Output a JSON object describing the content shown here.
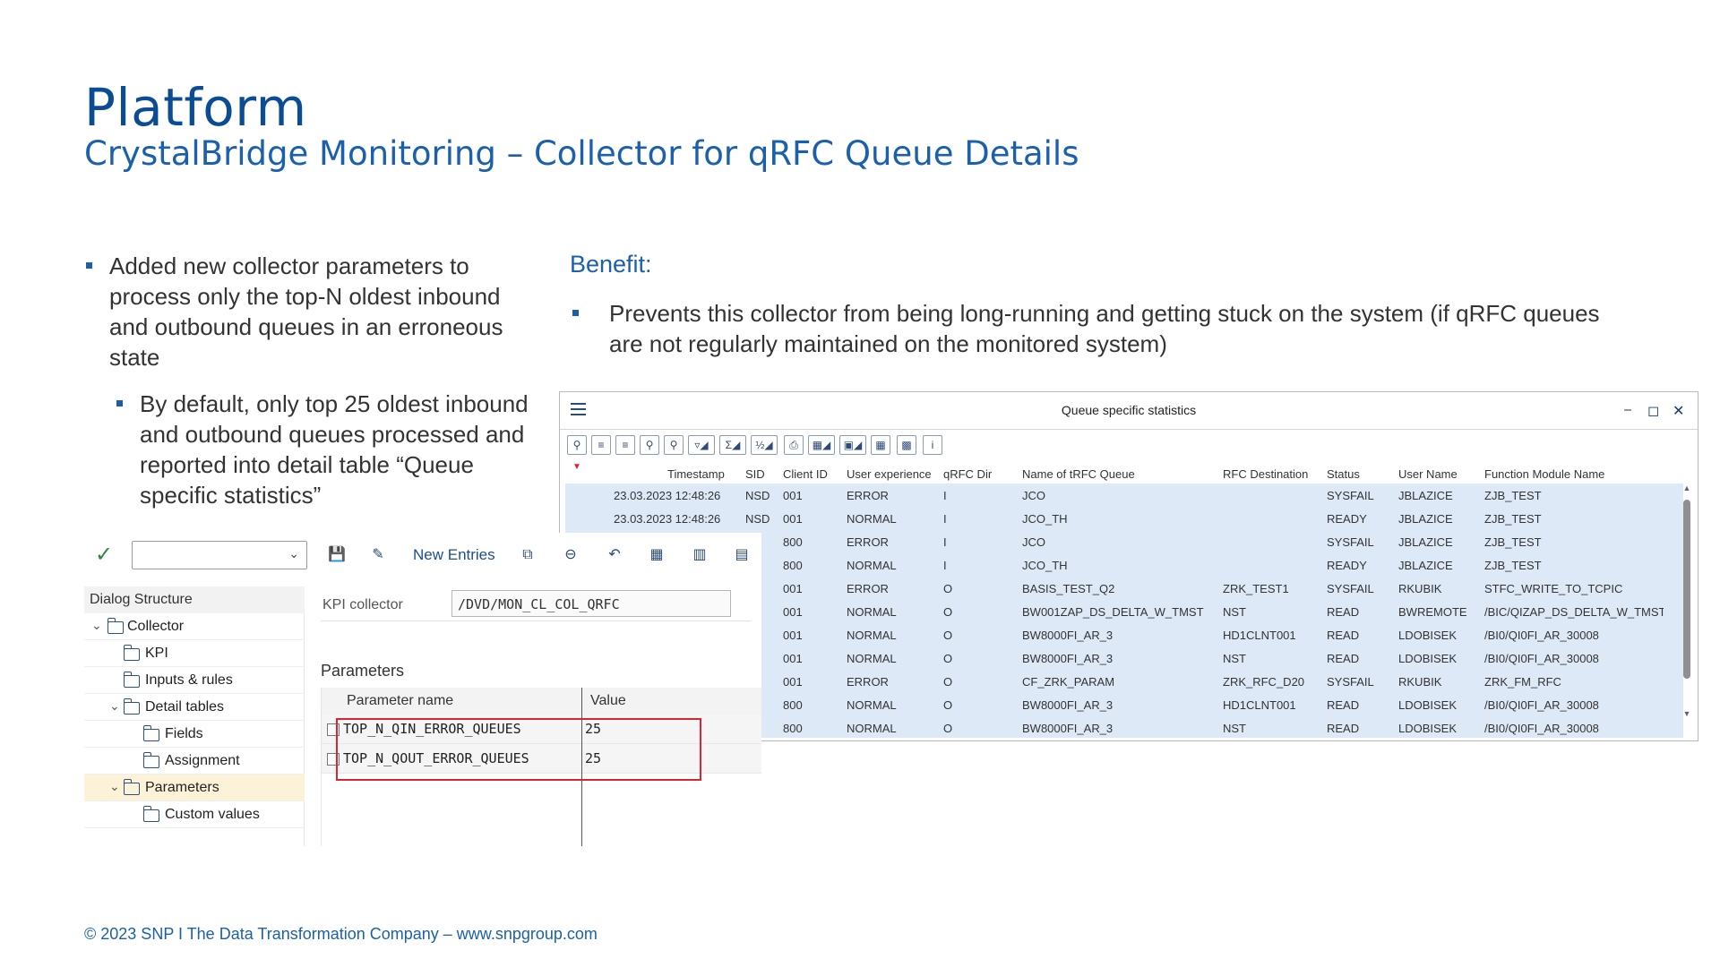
{
  "slide": {
    "title": "Platform",
    "subtitle": "CrystalBridge Monitoring – Collector for qRFC Queue Details",
    "bullet_main": "Added new collector parameters to process only the top-N oldest inbound and outbound queues in an erroneous state",
    "bullet_sub": "By default, only top 25 oldest inbound and outbound queues processed and reported into detail table “Queue specific statistics”",
    "benefit_heading": "Benefit:",
    "benefit_item": "Prevents this collector from being long-running and getting stuck on the system (if qRFC queues are not regularly maintained on the monitored system)",
    "footer": "© 2023 SNP I The Data Transformation Company – www.snpgroup.com"
  },
  "queue_window": {
    "title": "Queue specific statistics",
    "columns": [
      "Timestamp",
      "SID",
      "Client ID",
      "User experience",
      "qRFC Dir",
      "Name of tRFC Queue",
      "RFC Destination",
      "Status",
      "User Name",
      "Function Module Name"
    ],
    "rows": [
      [
        "23.03.2023 12:48:26",
        "NSD",
        "001",
        "ERROR",
        "I",
        "JCO",
        "",
        "SYSFAIL",
        "JBLAZICE",
        "ZJB_TEST"
      ],
      [
        "23.03.2023 12:48:26",
        "NSD",
        "001",
        "NORMAL",
        "I",
        "JCO_TH",
        "",
        "READY",
        "JBLAZICE",
        "ZJB_TEST"
      ],
      [
        "",
        "",
        "800",
        "ERROR",
        "I",
        "JCO",
        "",
        "SYSFAIL",
        "JBLAZICE",
        "ZJB_TEST"
      ],
      [
        "",
        "",
        "800",
        "NORMAL",
        "I",
        "JCO_TH",
        "",
        "READY",
        "JBLAZICE",
        "ZJB_TEST"
      ],
      [
        "",
        "",
        "001",
        "ERROR",
        "O",
        "BASIS_TEST_Q2",
        "ZRK_TEST1",
        "SYSFAIL",
        "RKUBIK",
        "STFC_WRITE_TO_TCPIC"
      ],
      [
        "",
        "",
        "001",
        "NORMAL",
        "O",
        "BW001ZAP_DS_DELTA_W_TMST",
        "NST",
        "READ",
        "BWREMOTE",
        "/BIC/QIZAP_DS_DELTA_W_TMST"
      ],
      [
        "",
        "",
        "001",
        "NORMAL",
        "O",
        "BW8000FI_AR_3",
        "HD1CLNT001",
        "READ",
        "LDOBISEK",
        "/BI0/QI0FI_AR_30008"
      ],
      [
        "",
        "",
        "001",
        "NORMAL",
        "O",
        "BW8000FI_AR_3",
        "NST",
        "READ",
        "LDOBISEK",
        "/BI0/QI0FI_AR_30008"
      ],
      [
        "",
        "",
        "001",
        "ERROR",
        "O",
        "CF_ZRK_PARAM",
        "ZRK_RFC_D20",
        "SYSFAIL",
        "RKUBIK",
        "ZRK_FM_RFC"
      ],
      [
        "",
        "",
        "800",
        "NORMAL",
        "O",
        "BW8000FI_AR_3",
        "HD1CLNT001",
        "READ",
        "LDOBISEK",
        "/BI0/QI0FI_AR_30008"
      ],
      [
        "",
        "",
        "800",
        "NORMAL",
        "O",
        "BW8000FI_AR_3",
        "NST",
        "READ",
        "LDOBISEK",
        "/BI0/QI0FI_AR_30008"
      ]
    ]
  },
  "dialog": {
    "new_entries": "New Entries",
    "tree_heading": "Dialog Structure",
    "tree": [
      "Collector",
      "KPI",
      "Inputs & rules",
      "Detail tables",
      "Fields",
      "Assignment",
      "Parameters",
      "Custom values"
    ],
    "kpi_label": "KPI collector",
    "kpi_value": "/DVD/MON_CL_COL_QRFC",
    "params_title": "Parameters",
    "param_col_name": "Parameter name",
    "param_col_value": "Value",
    "params": [
      {
        "name": "TOP_N_QIN_ERROR_QUEUES",
        "value": "25"
      },
      {
        "name": "TOP_N_QOUT_ERROR_QUEUES",
        "value": "25"
      }
    ]
  },
  "colors": {
    "brand_blue": "#0b4d94",
    "row_highlight": "#dde9f7",
    "highlight_box": "#d92630",
    "selected_node": "#fbf2d8"
  }
}
